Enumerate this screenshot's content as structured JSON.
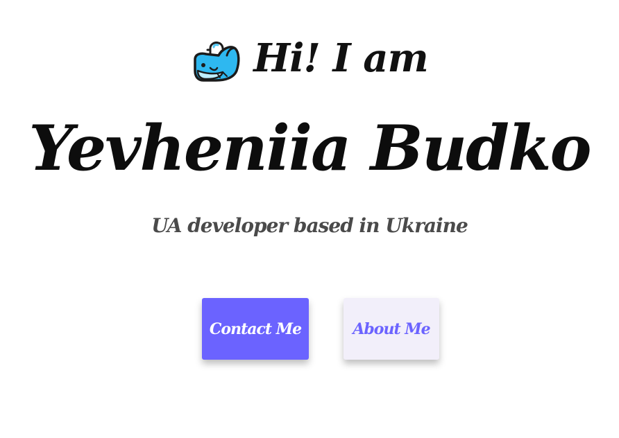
{
  "hero": {
    "greeting": "Hi! I am",
    "greeting_icon": "whale-icon",
    "name": "Yevheniia Budko",
    "tagline": "UA developer based in Ukraine"
  },
  "actions": {
    "contact_label": "Contact Me",
    "about_label": "About Me"
  },
  "colors": {
    "accent": "#6b63ff",
    "secondary_bg": "#f2effa",
    "heading": "#111111",
    "tagline": "#4a4a4a",
    "whale_body": "#2eb8f0",
    "whale_belly": "#bfeefe"
  }
}
